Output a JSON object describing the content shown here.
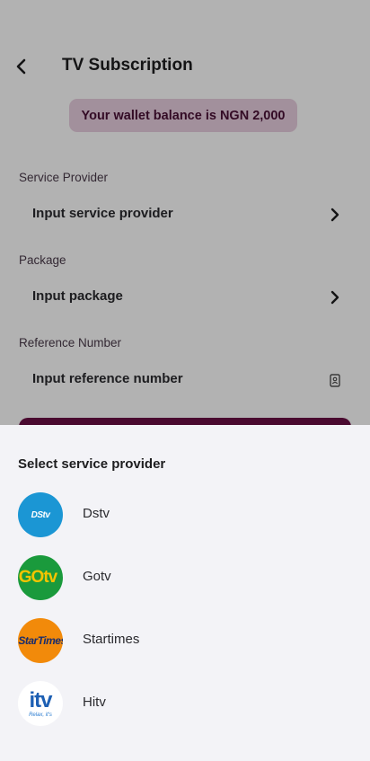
{
  "header": {
    "title": "TV Subscription"
  },
  "wallet": {
    "balance_text": "Your wallet balance is NGN 2,000"
  },
  "form": {
    "service_provider": {
      "label": "Service Provider",
      "placeholder": "Input service provider"
    },
    "package": {
      "label": "Package",
      "placeholder": "Input package"
    },
    "reference": {
      "label": "Reference Number",
      "placeholder": "Input reference number"
    }
  },
  "sheet": {
    "title": "Select service provider",
    "providers": [
      {
        "name": "Dstv",
        "logo_text": "DStv"
      },
      {
        "name": "Gotv",
        "logo_text": "GOtv"
      },
      {
        "name": "Startimes",
        "logo_text": "StarTimes"
      },
      {
        "name": "Hitv",
        "logo_text": "itv",
        "logo_tagline": "Relax, it's"
      }
    ]
  },
  "colors": {
    "brand": "#6b0f45",
    "balance_bg": "#e8cfe0",
    "sheet_bg": "#f3f3f7"
  }
}
